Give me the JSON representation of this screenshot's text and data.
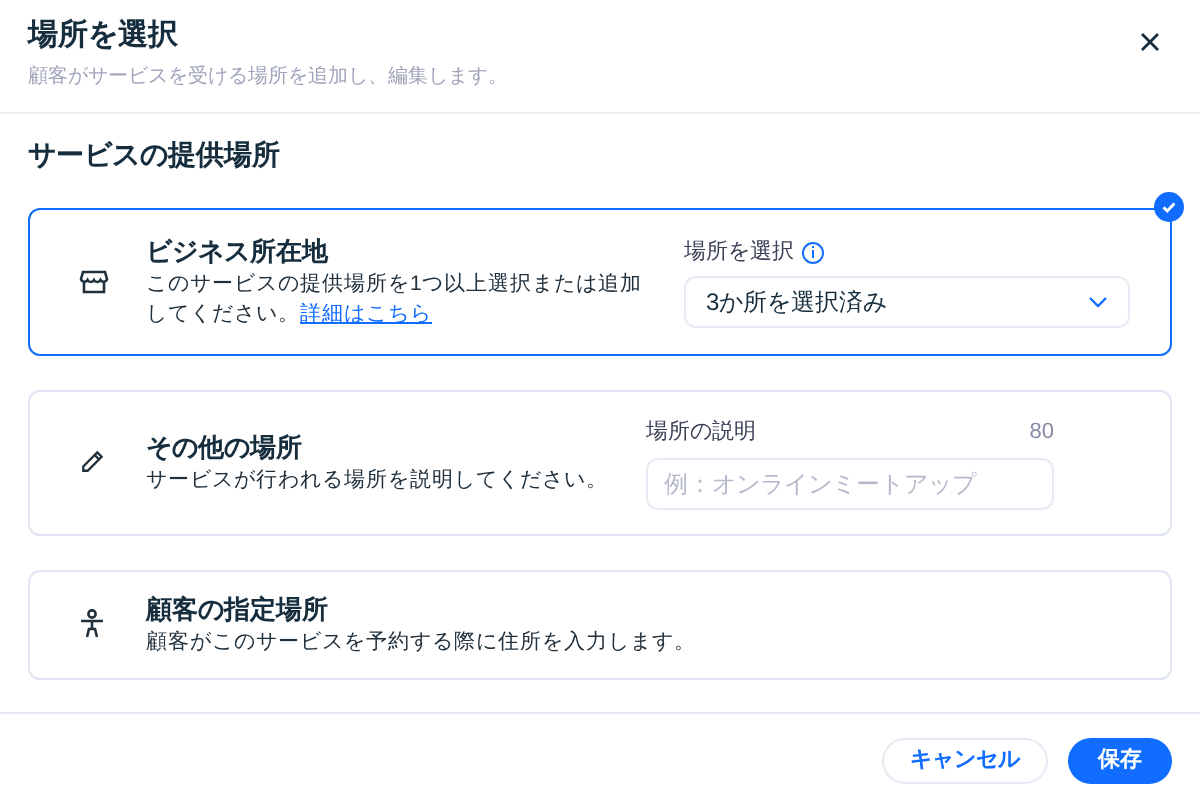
{
  "dialog": {
    "title": "場所を選択",
    "subtitle": "顧客がサービスを受ける場所を追加し、編集します。"
  },
  "section": {
    "title": "サービスの提供場所"
  },
  "options": [
    {
      "kind": "select",
      "selected": true,
      "title": "ビジネス所在地",
      "description": "このサービスの提供場所を1つ以上選択または追加してください。",
      "link": "詳細はこちら",
      "field": {
        "label": "場所を選択",
        "value": "3か所を選択済み"
      }
    },
    {
      "kind": "text",
      "selected": false,
      "title": "その他の場所",
      "description": "サービスが行われる場所を説明してください。",
      "field": {
        "label": "場所の説明",
        "counter": "80",
        "placeholder": "例：オンラインミートアップ"
      }
    },
    {
      "kind": "plain",
      "selected": false,
      "title": "顧客の指定場所",
      "description": "顧客がこのサービスを予約する際に住所を入力します。"
    }
  ],
  "buttons": {
    "cancel": "キャンセル",
    "save": "保存"
  }
}
